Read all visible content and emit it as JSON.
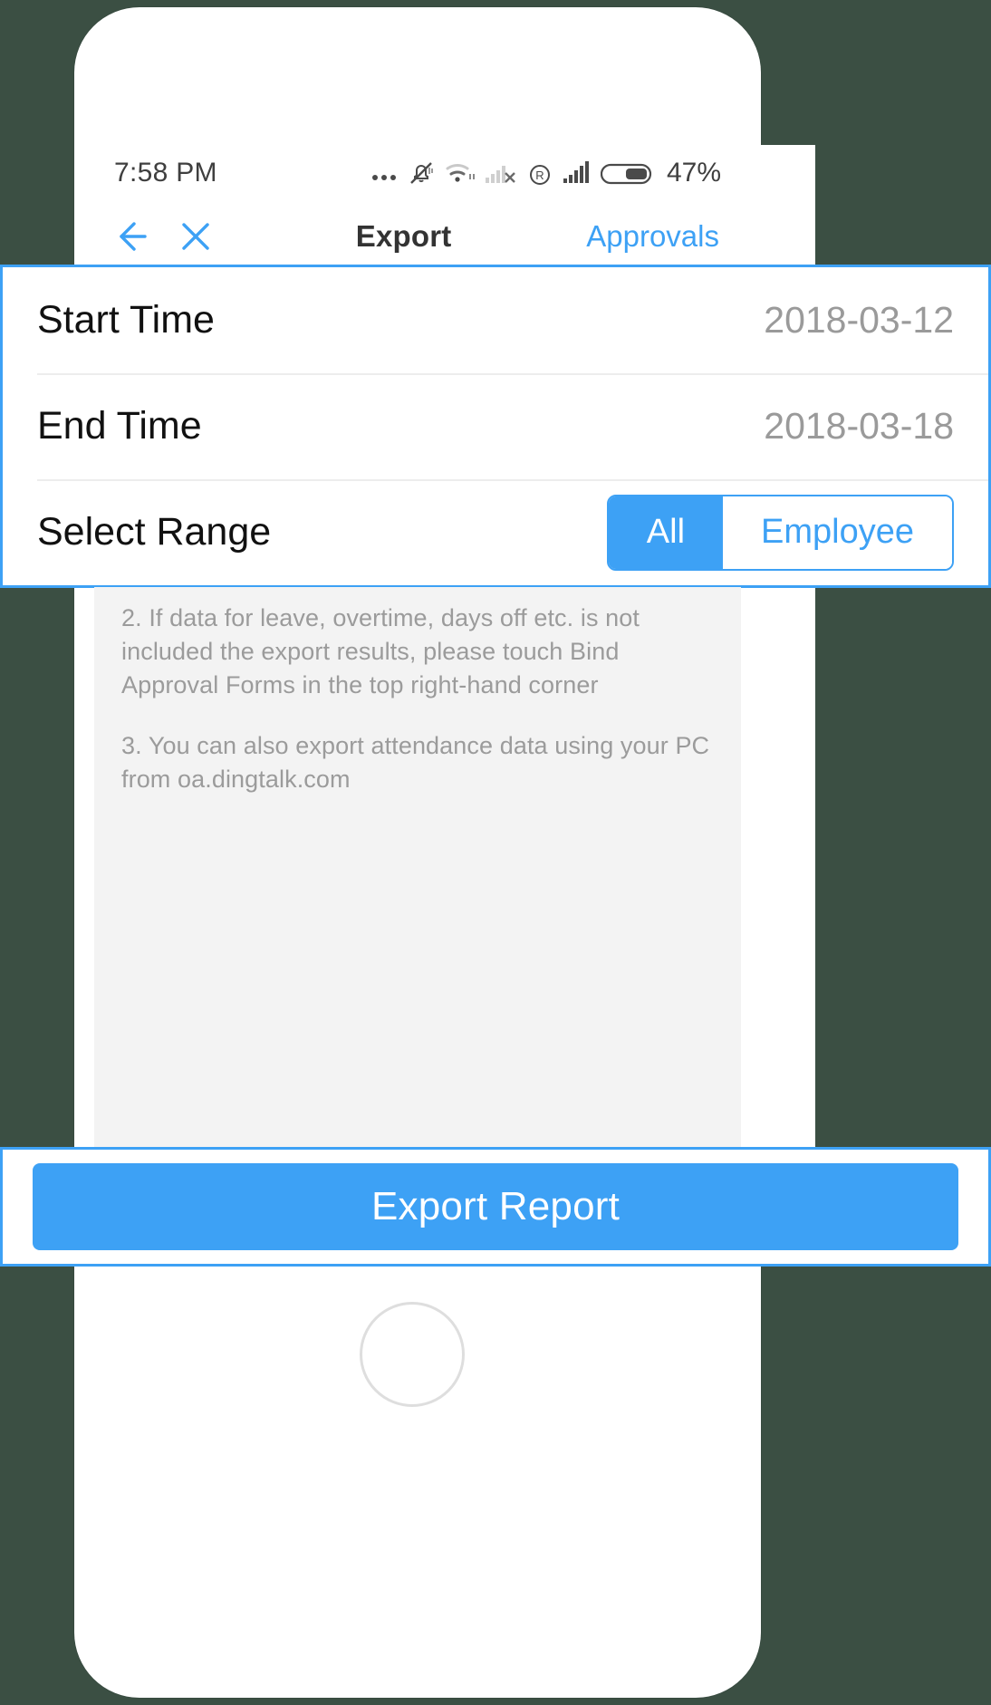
{
  "status_bar": {
    "time": "7:58 PM",
    "battery_percent": "47%",
    "icons": [
      "ellipsis-icon",
      "bell-muted-icon",
      "wifi-icon",
      "signal-no-service-icon",
      "registered-r-icon",
      "signal-bars-icon",
      "battery-icon"
    ]
  },
  "nav_bar": {
    "back_icon": "back-arrow-icon",
    "close_icon": "close-x-icon",
    "title": "Export",
    "action_label": "Approvals"
  },
  "form": {
    "rows": [
      {
        "label": "Start Time",
        "value": "2018-03-12"
      },
      {
        "label": "End Time",
        "value": "2018-03-18"
      }
    ],
    "select_range": {
      "label": "Select Range",
      "options": [
        {
          "label": "All",
          "selected": true
        },
        {
          "label": "Employee",
          "selected": false
        }
      ]
    }
  },
  "content": {
    "tips": [
      "2. If data for leave, overtime, days off etc. is not included the export results, please touch Bind Approval Forms in the top right-hand corner",
      "3. You can also export attendance data using your PC from oa.dingtalk.com"
    ]
  },
  "cta": {
    "label": "Export Report"
  },
  "colors": {
    "accent": "#3da1f5",
    "page_background": "#3b4f43",
    "content_background": "#f3f3f3",
    "label_text": "#111111",
    "value_text": "#9a9a9a",
    "tip_text": "#9b9b9b"
  }
}
